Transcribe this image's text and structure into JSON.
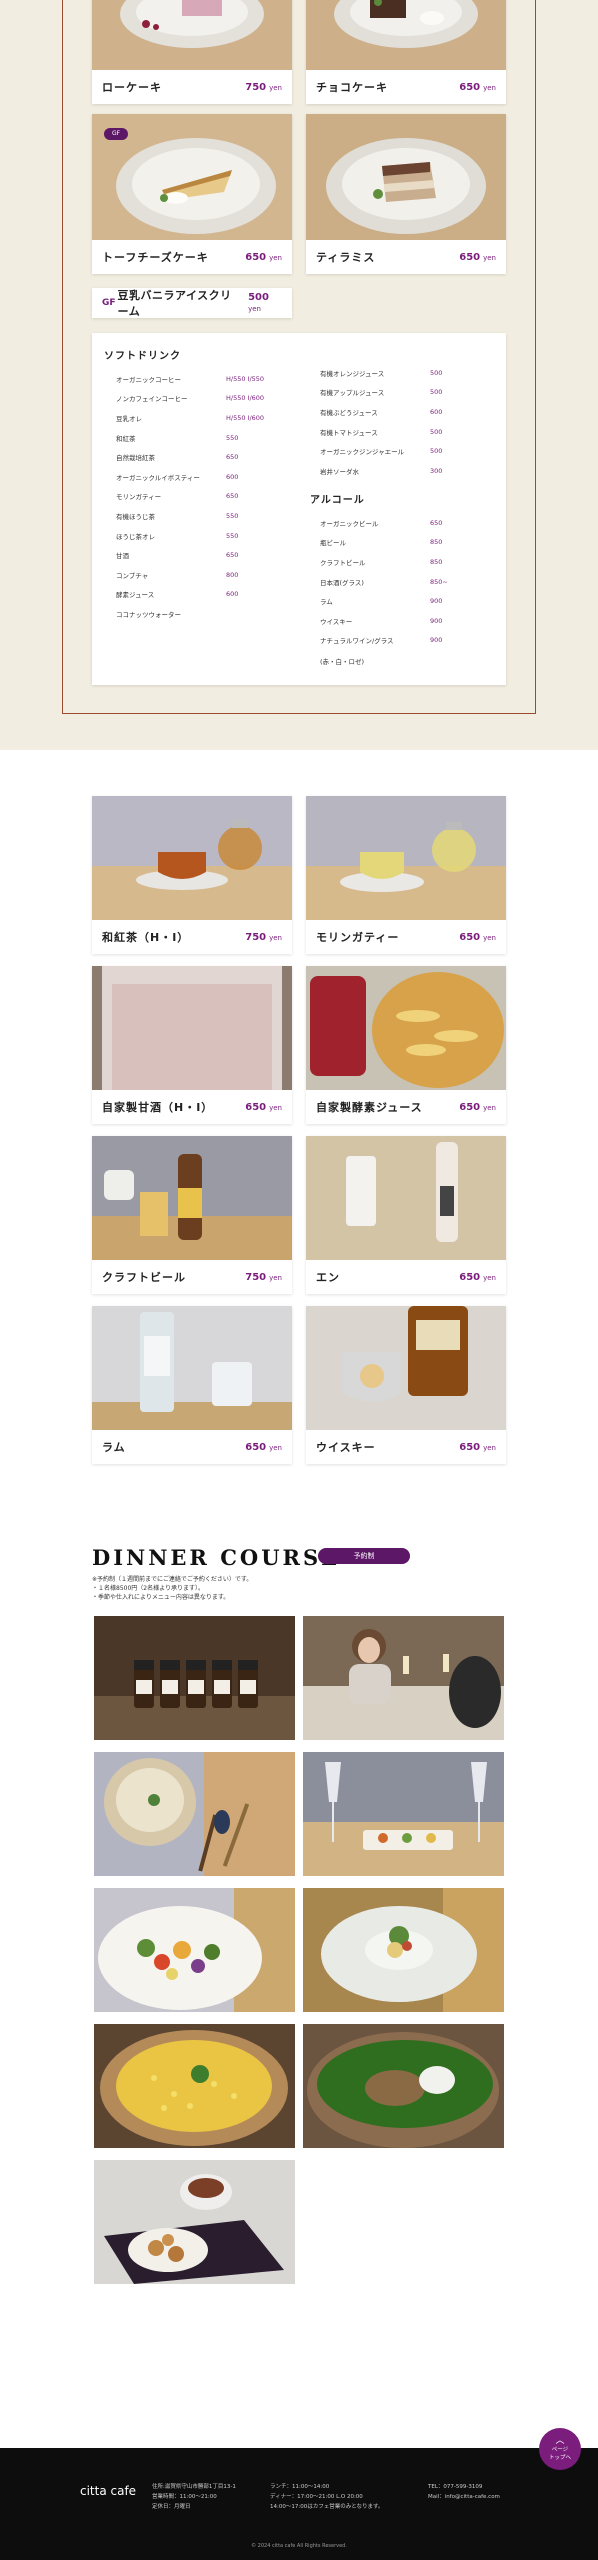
{
  "desserts": [
    {
      "name": "ローケーキ",
      "price": "750",
      "unit": "yen"
    },
    {
      "name": "チョコケーキ",
      "price": "650",
      "unit": "yen"
    },
    {
      "name": "トーフチーズケーキ",
      "price": "650",
      "unit": "yen",
      "badge": "GF"
    },
    {
      "name": "ティラミス",
      "price": "650",
      "unit": "yen"
    }
  ],
  "icecream": {
    "mark": "GF",
    "name": "豆乳バニラアイスクリーム",
    "price": "500",
    "unit": "yen"
  },
  "soft_drinks": {
    "heading": "ソフトドリンク",
    "left": [
      {
        "name": "オーガニックコーヒー",
        "price": "H/550 I/550"
      },
      {
        "name": "ノンカフェインコーヒー",
        "price": "H/550 I/600"
      },
      {
        "name": "豆乳オレ",
        "price": "H/550 I/600"
      },
      {
        "name": "和紅茶",
        "price": "550"
      },
      {
        "name": "自然栽培紅茶",
        "price": "650"
      },
      {
        "name": "オーガニックルイボスティー",
        "price": "600"
      },
      {
        "name": "モリンガティー",
        "price": "650"
      },
      {
        "name": "有機ほうじ茶",
        "price": "550"
      },
      {
        "name": "ほうじ茶オレ",
        "price": "550"
      },
      {
        "name": "甘酒",
        "price": "650"
      },
      {
        "name": "コンブチャ",
        "price": "800"
      },
      {
        "name": "酵素ジュース",
        "price": "600"
      },
      {
        "name": "ココナッツウォーター",
        "price": ""
      }
    ],
    "right": [
      {
        "name": "有機オレンジジュース",
        "price": "500"
      },
      {
        "name": "有機アップルジュース",
        "price": "500"
      },
      {
        "name": "有機ぶどうジュース",
        "price": "600"
      },
      {
        "name": "有機トマトジュース",
        "price": "500"
      },
      {
        "name": "オーガニックジンジャエール",
        "price": "500"
      },
      {
        "name": "岩井ソーダ水",
        "price": "300"
      }
    ]
  },
  "alcohol": {
    "heading": "アルコール",
    "items": [
      {
        "name": "オーガニックビール",
        "price": "650"
      },
      {
        "name": "瓶ビール",
        "price": "850"
      },
      {
        "name": "クラフトビール",
        "price": "850"
      },
      {
        "name": "日本酒(グラス)",
        "price": "850~"
      },
      {
        "name": "ラム",
        "price": "900"
      },
      {
        "name": "ウイスキー",
        "price": "900"
      },
      {
        "name": "ナチュラルワイン/グラス",
        "price": "900"
      }
    ],
    "note": "(赤・白・ロゼ)"
  },
  "drinks": [
    {
      "name": "和紅茶（H・I）",
      "price": "750",
      "unit": "yen"
    },
    {
      "name": "モリンガティー",
      "price": "650",
      "unit": "yen"
    },
    {
      "name": "自家製甘酒（H・I）",
      "price": "650",
      "unit": "yen"
    },
    {
      "name": "自家製酵素ジュース",
      "price": "650",
      "unit": "yen"
    },
    {
      "name": "クラフトビール",
      "price": "750",
      "unit": "yen"
    },
    {
      "name": "エン",
      "price": "650",
      "unit": "yen"
    },
    {
      "name": "ラム",
      "price": "650",
      "unit": "yen"
    },
    {
      "name": "ウイスキー",
      "price": "650",
      "unit": "yen"
    }
  ],
  "dinner": {
    "title": "DINNER COURSE",
    "reserve_label": "予約制",
    "notes": [
      "※予約制（１週間前までにご連絡でご予約ください）です。",
      "・１名様8500円（2名様より承ります）。",
      "・季節や仕入れによりメニュー内容は異なります。"
    ]
  },
  "pagetop": {
    "label1": "ページ",
    "label2": "トップへ"
  },
  "footer": {
    "logo": "citta cafe",
    "address": [
      "住所:滋賀県守山市勝部1丁目13-1",
      "営業時間：11:00～21:00",
      "定休日：月曜日"
    ],
    "hours": [
      "ランチ：11:00～14:00",
      "ディナー：17:00～21:00 L.O 20:00",
      "14:00～17:00はカフェ営業のみとなります。"
    ],
    "contact": [
      "TEL：077-599-3109",
      "Mail：info@citta-cafe.com"
    ],
    "copyright": "© 2024 citta cafe All Rights Reserved."
  },
  "colors": {
    "accent": "#7a1d7c",
    "badge": "#5c1766",
    "beige": "#f1ede0",
    "footer": "#0d0d0d",
    "frame": "#9b4b2f"
  }
}
